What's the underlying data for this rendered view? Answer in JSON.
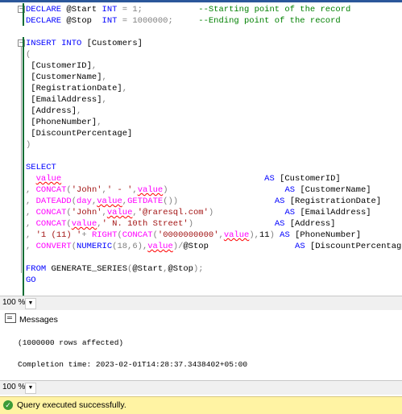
{
  "editor": {
    "lines": [
      [
        {
          "t": "DECLARE ",
          "c": "kw"
        },
        {
          "t": "@Start ",
          "c": "id"
        },
        {
          "t": "INT ",
          "c": "kw"
        },
        {
          "t": "= 1;           ",
          "c": "gr"
        },
        {
          "t": "--Starting point of the record",
          "c": "cm"
        }
      ],
      [
        {
          "t": "DECLARE ",
          "c": "kw"
        },
        {
          "t": "@Stop  ",
          "c": "id"
        },
        {
          "t": "INT ",
          "c": "kw"
        },
        {
          "t": "= 1000000;     ",
          "c": "gr"
        },
        {
          "t": "--Ending point of the record",
          "c": "cm"
        }
      ],
      [],
      [
        {
          "t": "INSERT INTO ",
          "c": "kw"
        },
        {
          "t": "[Customers]",
          "c": "id"
        }
      ],
      [
        {
          "t": "(",
          "c": "gr"
        }
      ],
      [
        {
          "t": " [CustomerID]",
          "c": "id"
        },
        {
          "t": ",",
          "c": "gr"
        }
      ],
      [
        {
          "t": " [CustomerName]",
          "c": "id"
        },
        {
          "t": ",",
          "c": "gr"
        }
      ],
      [
        {
          "t": " [RegistrationDate]",
          "c": "id"
        },
        {
          "t": ",",
          "c": "gr"
        }
      ],
      [
        {
          "t": " [EmailAddress]",
          "c": "id"
        },
        {
          "t": ",",
          "c": "gr"
        }
      ],
      [
        {
          "t": " [Address]",
          "c": "id"
        },
        {
          "t": ",",
          "c": "gr"
        }
      ],
      [
        {
          "t": " [PhoneNumber]",
          "c": "id"
        },
        {
          "t": ",",
          "c": "gr"
        }
      ],
      [
        {
          "t": " [DiscountPercentage]",
          "c": "id"
        }
      ],
      [
        {
          "t": ")",
          "c": "gr"
        }
      ],
      [],
      [
        {
          "t": "SELECT",
          "c": "kw"
        }
      ],
      [
        {
          "t": "  ",
          "c": "id"
        },
        {
          "t": "value",
          "c": "fn sq"
        },
        {
          "t": "                                        ",
          "c": "id"
        },
        {
          "t": "AS ",
          "c": "kw"
        },
        {
          "t": "[CustomerID]",
          "c": "id"
        }
      ],
      [
        {
          "t": ", ",
          "c": "gr"
        },
        {
          "t": "CONCAT",
          "c": "fn"
        },
        {
          "t": "(",
          "c": "gr"
        },
        {
          "t": "'John'",
          "c": "st"
        },
        {
          "t": ",",
          "c": "gr"
        },
        {
          "t": "' - '",
          "c": "st"
        },
        {
          "t": ",",
          "c": "gr"
        },
        {
          "t": "value",
          "c": "fn sq"
        },
        {
          "t": ")",
          "c": "gr"
        },
        {
          "t": "                       ",
          "c": "id"
        },
        {
          "t": "AS ",
          "c": "kw"
        },
        {
          "t": "[CustomerName]",
          "c": "id"
        }
      ],
      [
        {
          "t": ", ",
          "c": "gr"
        },
        {
          "t": "DATEADD",
          "c": "fn"
        },
        {
          "t": "(",
          "c": "gr"
        },
        {
          "t": "day",
          "c": "fn"
        },
        {
          "t": ",",
          "c": "gr"
        },
        {
          "t": "value",
          "c": "fn sq"
        },
        {
          "t": ",",
          "c": "gr"
        },
        {
          "t": "GETDATE",
          "c": "fn"
        },
        {
          "t": "())",
          "c": "gr"
        },
        {
          "t": "                   ",
          "c": "id"
        },
        {
          "t": "AS ",
          "c": "kw"
        },
        {
          "t": "[RegistrationDate]",
          "c": "id"
        }
      ],
      [
        {
          "t": ", ",
          "c": "gr"
        },
        {
          "t": "CONCAT",
          "c": "fn"
        },
        {
          "t": "(",
          "c": "gr"
        },
        {
          "t": "'John'",
          "c": "st"
        },
        {
          "t": ",",
          "c": "gr"
        },
        {
          "t": "value",
          "c": "fn sq"
        },
        {
          "t": ",",
          "c": "gr"
        },
        {
          "t": "'@raresql.com'",
          "c": "st"
        },
        {
          "t": ")",
          "c": "gr"
        },
        {
          "t": "              ",
          "c": "id"
        },
        {
          "t": "AS ",
          "c": "kw"
        },
        {
          "t": "[EmailAddress]",
          "c": "id"
        }
      ],
      [
        {
          "t": ", ",
          "c": "gr"
        },
        {
          "t": "CONCAT",
          "c": "fn"
        },
        {
          "t": "(",
          "c": "gr"
        },
        {
          "t": "value",
          "c": "fn sq"
        },
        {
          "t": ",",
          "c": "gr"
        },
        {
          "t": "' N. 10th Street'",
          "c": "st"
        },
        {
          "t": ")",
          "c": "gr"
        },
        {
          "t": "                ",
          "c": "id"
        },
        {
          "t": "AS ",
          "c": "kw"
        },
        {
          "t": "[Address]",
          "c": "id"
        }
      ],
      [
        {
          "t": ", ",
          "c": "gr"
        },
        {
          "t": "'1 (11) '",
          "c": "st"
        },
        {
          "t": "+ ",
          "c": "gr"
        },
        {
          "t": "RIGHT",
          "c": "fn"
        },
        {
          "t": "(",
          "c": "gr"
        },
        {
          "t": "CONCAT",
          "c": "fn"
        },
        {
          "t": "(",
          "c": "gr"
        },
        {
          "t": "'0000000000'",
          "c": "st"
        },
        {
          "t": ",",
          "c": "gr"
        },
        {
          "t": "value",
          "c": "fn sq"
        },
        {
          "t": "),",
          "c": "gr"
        },
        {
          "t": "11",
          "c": "id"
        },
        {
          "t": ") ",
          "c": "gr"
        },
        {
          "t": "AS ",
          "c": "kw"
        },
        {
          "t": "[PhoneNumber]",
          "c": "id"
        }
      ],
      [
        {
          "t": ", ",
          "c": "gr"
        },
        {
          "t": "CONVERT",
          "c": "fn"
        },
        {
          "t": "(",
          "c": "gr"
        },
        {
          "t": "NUMERIC",
          "c": "kw"
        },
        {
          "t": "(18,6),",
          "c": "gr"
        },
        {
          "t": "value",
          "c": "fn sq"
        },
        {
          "t": ")/",
          "c": "gr"
        },
        {
          "t": "@Stop",
          "c": "id"
        },
        {
          "t": "                 ",
          "c": "id"
        },
        {
          "t": "AS ",
          "c": "kw"
        },
        {
          "t": "[DiscountPercentage]",
          "c": "id"
        }
      ],
      [],
      [
        {
          "t": "FROM ",
          "c": "kw"
        },
        {
          "t": "GENERATE_SERIES",
          "c": "id"
        },
        {
          "t": "(",
          "c": "gr"
        },
        {
          "t": "@Start",
          "c": "id"
        },
        {
          "t": ",",
          "c": "gr"
        },
        {
          "t": "@Stop",
          "c": "id"
        },
        {
          "t": ");",
          "c": "gr"
        }
      ],
      [
        {
          "t": "GO",
          "c": "kw"
        }
      ]
    ]
  },
  "editor_zoom": {
    "value": "100 %"
  },
  "results_tab": {
    "label": "Messages"
  },
  "messages": {
    "rows_affected": "(1000000 rows affected)",
    "completion": "Completion time: 2023-02-01T14:28:37.3438402+05:00"
  },
  "results_zoom": {
    "value": "100 %"
  },
  "status": {
    "text": "Query executed successfully.",
    "color": "#fff3a3"
  }
}
